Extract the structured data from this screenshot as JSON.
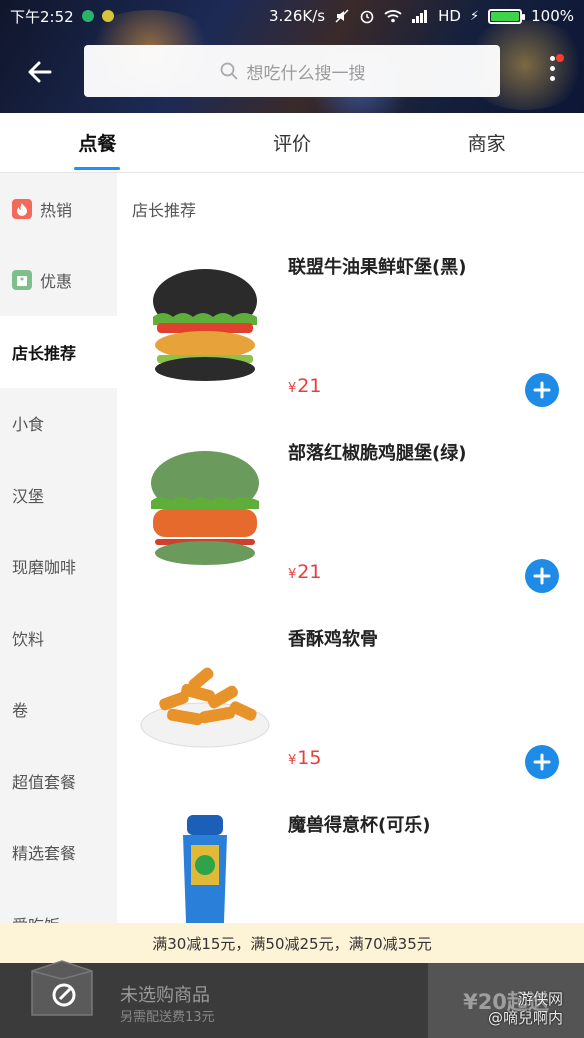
{
  "status_bar": {
    "time": "下午2:52",
    "speed": "3.26K/s",
    "network": "HD",
    "battery": "100%"
  },
  "header": {
    "search_placeholder": "想吃什么搜一搜"
  },
  "tabs": [
    {
      "label": "点餐",
      "active": true
    },
    {
      "label": "评价",
      "active": false
    },
    {
      "label": "商家",
      "active": false
    }
  ],
  "sidebar": {
    "items": [
      {
        "label": "热销",
        "icon": "fire-icon"
      },
      {
        "label": "优惠",
        "icon": "discount-tag-icon"
      },
      {
        "label": "店长推荐",
        "active": true
      },
      {
        "label": "小食"
      },
      {
        "label": "汉堡"
      },
      {
        "label": "现磨咖啡"
      },
      {
        "label": "饮料"
      },
      {
        "label": "卷"
      },
      {
        "label": "超值套餐"
      },
      {
        "label": "精选套餐"
      },
      {
        "label": "爱吃饭"
      }
    ]
  },
  "menu": {
    "section_title": "店长推荐",
    "currency": "¥",
    "items": [
      {
        "name": "联盟牛油果鲜虾堡(黑)",
        "price": "21"
      },
      {
        "name": "部落红椒脆鸡腿堡(绿)",
        "price": "21"
      },
      {
        "name": "香酥鸡软骨",
        "price": "15"
      },
      {
        "name": "魔兽得意杯(可乐)",
        "price": ""
      }
    ]
  },
  "promo": {
    "text": "满30减15元，满50减25元，满70减35元"
  },
  "cart": {
    "empty_text": "未选购商品",
    "delivery_fee": "另需配送费13元",
    "min_order": "¥20起送"
  },
  "watermark": {
    "line1": "游侠网",
    "line2": "@嘀兒啊内"
  },
  "colors": {
    "accent": "#1e8be6",
    "price": "#e83d3d",
    "promo_bg": "#fdf3d7",
    "cart_bg": "#3b3b3b"
  }
}
